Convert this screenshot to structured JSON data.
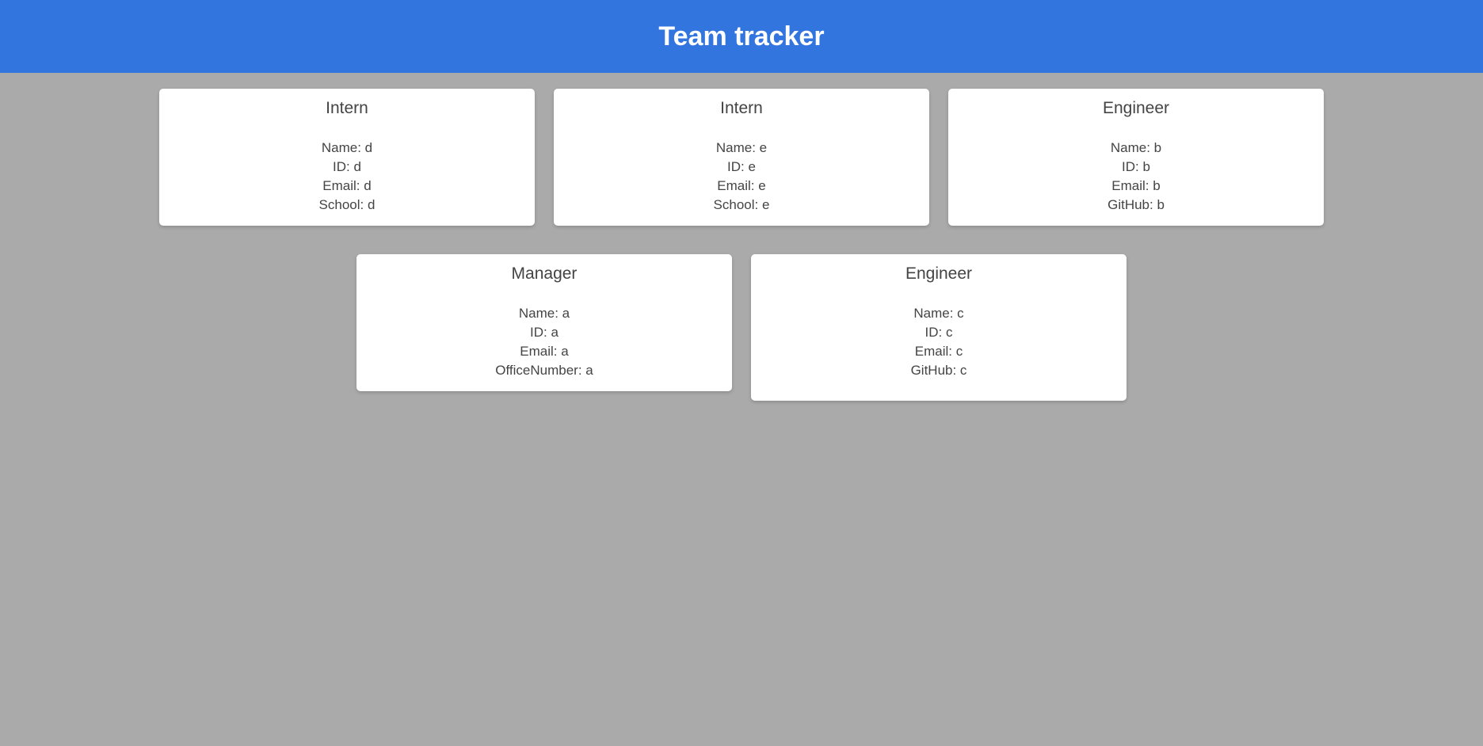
{
  "header": {
    "title": "Team tracker"
  },
  "cards": [
    {
      "role": "Intern",
      "name": "Name: d",
      "id": "ID: d",
      "email": "Email: d",
      "extra": "School: d"
    },
    {
      "role": "Intern",
      "name": "Name: e",
      "id": "ID: e",
      "email": "Email: e",
      "extra": "School: e"
    },
    {
      "role": "Engineer",
      "name": "Name: b",
      "id": "ID: b",
      "email": "Email: b",
      "extra": "GitHub: b"
    },
    {
      "role": "Manager",
      "name": "Name: a",
      "id": "ID: a",
      "email": "Email: a",
      "extra": "OfficeNumber: a"
    },
    {
      "role": "Engineer",
      "name": "Name: c",
      "id": "ID: c",
      "email": "Email: c",
      "extra": "GitHub: c"
    }
  ],
  "colors": {
    "header_bg": "#3375de",
    "page_bg": "#aaaaaa",
    "card_bg": "#ffffff",
    "text": "#444444"
  }
}
